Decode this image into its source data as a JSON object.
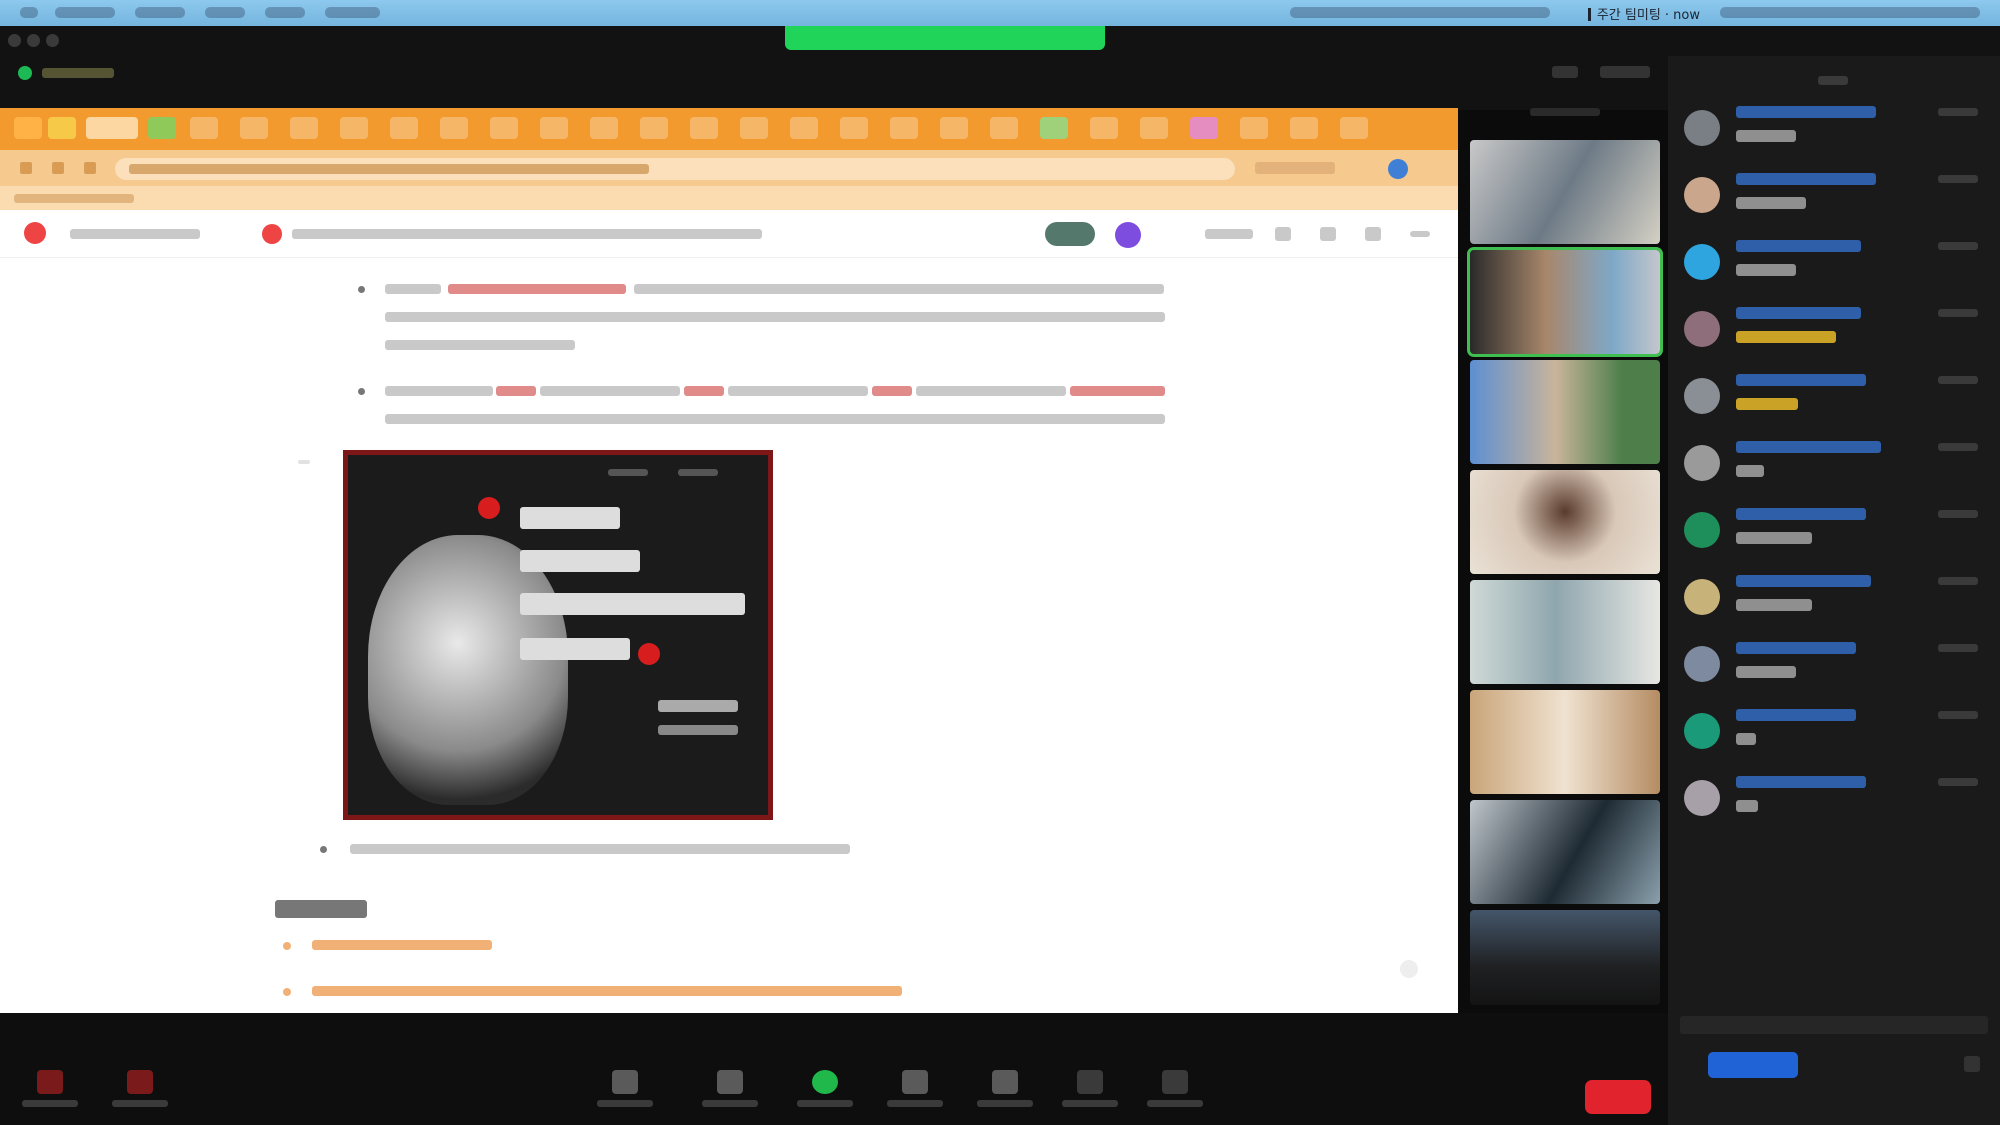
{
  "menubar": {
    "meeting_status": "주간 팀미팅 · now"
  },
  "colors": {
    "share_indicator": "#20d45a",
    "browser_tabstrip": "#f29a2e",
    "end_button": "#e0232c",
    "panel_bg": "#1a1a1a",
    "name_link": "#2f5fa8"
  },
  "icons": {
    "toolbar_buttons": [
      "mic-icon",
      "video-icon",
      "security-icon",
      "participants-icon",
      "share-screen-icon",
      "chat-icon",
      "record-icon",
      "reactions-icon",
      "more-icon"
    ]
  }
}
